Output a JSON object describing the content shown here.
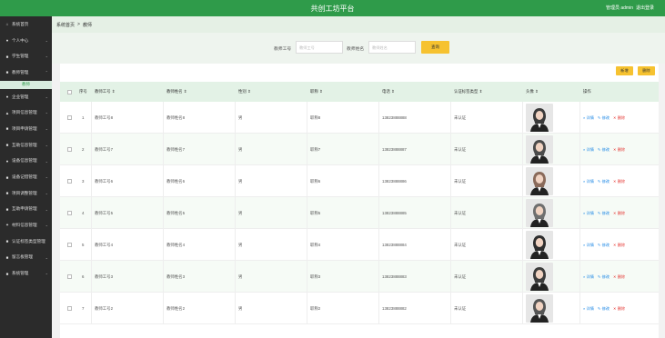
{
  "header": {
    "title": "共创工坊平台",
    "user_label": "管理员 admin",
    "logout": "退出登录"
  },
  "sidebar": {
    "items": [
      {
        "icon": "home-icon",
        "glyph": "⌂",
        "label": "系统首页",
        "has_arrow": false
      },
      {
        "icon": "user-icon",
        "glyph": "●",
        "label": "个人中心",
        "has_arrow": true
      },
      {
        "icon": "grid-icon",
        "glyph": "■",
        "label": "学生管理",
        "has_arrow": true
      },
      {
        "icon": "grid-icon",
        "glyph": "■",
        "label": "教师管理",
        "has_arrow": true,
        "expanded": true
      },
      {
        "icon": "user-icon",
        "glyph": "●",
        "label": "企业管理",
        "has_arrow": true
      },
      {
        "icon": "bank-icon",
        "glyph": "▲",
        "label": "项目信息管理",
        "has_arrow": true
      },
      {
        "icon": "grid-icon",
        "glyph": "■",
        "label": "项目申请管理",
        "has_arrow": true
      },
      {
        "icon": "grid-icon",
        "glyph": "■",
        "label": "互助信息管理",
        "has_arrow": true
      },
      {
        "icon": "user-icon",
        "glyph": "●",
        "label": "设备信息管理",
        "has_arrow": true
      },
      {
        "icon": "grid-icon",
        "glyph": "■",
        "label": "设备记借管理",
        "has_arrow": true
      },
      {
        "icon": "grid-icon",
        "glyph": "■",
        "label": "项目调整管理",
        "has_arrow": true
      },
      {
        "icon": "grid-icon",
        "glyph": "■",
        "label": "互助申请管理",
        "has_arrow": true
      },
      {
        "icon": "gear-icon",
        "glyph": "✦",
        "label": "材料信息管理",
        "has_arrow": true
      },
      {
        "icon": "grid-icon",
        "glyph": "■",
        "label": "认证标签类型管理",
        "has_arrow": false
      },
      {
        "icon": "grid-icon",
        "glyph": "■",
        "label": "留言板管理",
        "has_arrow": true
      },
      {
        "icon": "grid-icon",
        "glyph": "■",
        "label": "系统管理",
        "has_arrow": true
      }
    ],
    "sub_item": "教师"
  },
  "breadcrumb": {
    "home": "系统首页",
    "separator": ">",
    "current": "教师"
  },
  "search": {
    "field1_label": "教师工号",
    "field1_placeholder": "教师工号",
    "field2_label": "教师姓名",
    "field2_placeholder": "教师姓名",
    "button": "查询"
  },
  "toolbar": {
    "add": "新增",
    "delete": "删除"
  },
  "table": {
    "headers": {
      "index": "序号",
      "teacher_no": "教师工号 ⇕",
      "teacher_name": "教师姓名 ⇕",
      "gender": "性别 ⇕",
      "title": "职称 ⇕",
      "phone": "电话 ⇕",
      "cert_type": "认证标签类型 ⇕",
      "avatar": "头像 ⇕",
      "ops": "操作"
    },
    "ops": {
      "detail": "详情",
      "edit": "修改",
      "delete": "删除"
    },
    "rows": [
      {
        "index": "1",
        "no": "教师工号8",
        "name": "教师姓名8",
        "gender": "男",
        "title": "职称8",
        "phone": "13823888888",
        "cert": "未认证",
        "avatar_color": "#3a3a3a"
      },
      {
        "index": "2",
        "no": "教师工号7",
        "name": "教师姓名7",
        "gender": "男",
        "title": "职称7",
        "phone": "13823888887",
        "cert": "未认证",
        "avatar_color": "#4b4b4b"
      },
      {
        "index": "3",
        "no": "教师工号6",
        "name": "教师姓名6",
        "gender": "男",
        "title": "职称6",
        "phone": "13823888886",
        "cert": "未认证",
        "avatar_color": "#8a6a5a"
      },
      {
        "index": "4",
        "no": "教师工号5",
        "name": "教师姓名5",
        "gender": "男",
        "title": "职称5",
        "phone": "13823888885",
        "cert": "未认证",
        "avatar_color": "#6f6f6f"
      },
      {
        "index": "5",
        "no": "教师工号4",
        "name": "教师姓名4",
        "gender": "男",
        "title": "职称4",
        "phone": "13823888884",
        "cert": "未认证",
        "avatar_color": "#2e2e2e"
      },
      {
        "index": "6",
        "no": "教师工号3",
        "name": "教师姓名3",
        "gender": "男",
        "title": "职称3",
        "phone": "13823888883",
        "cert": "未认证",
        "avatar_color": "#3c3c3c"
      },
      {
        "index": "7",
        "no": "教师工号2",
        "name": "教师姓名2",
        "gender": "男",
        "title": "职称2",
        "phone": "13823888882",
        "cert": "未认证",
        "avatar_color": "#555555"
      }
    ]
  },
  "colors": {
    "brand_green": "#2f9b4a",
    "accent_yellow": "#f6c230",
    "sidebar_bg": "#2b2b2b"
  }
}
